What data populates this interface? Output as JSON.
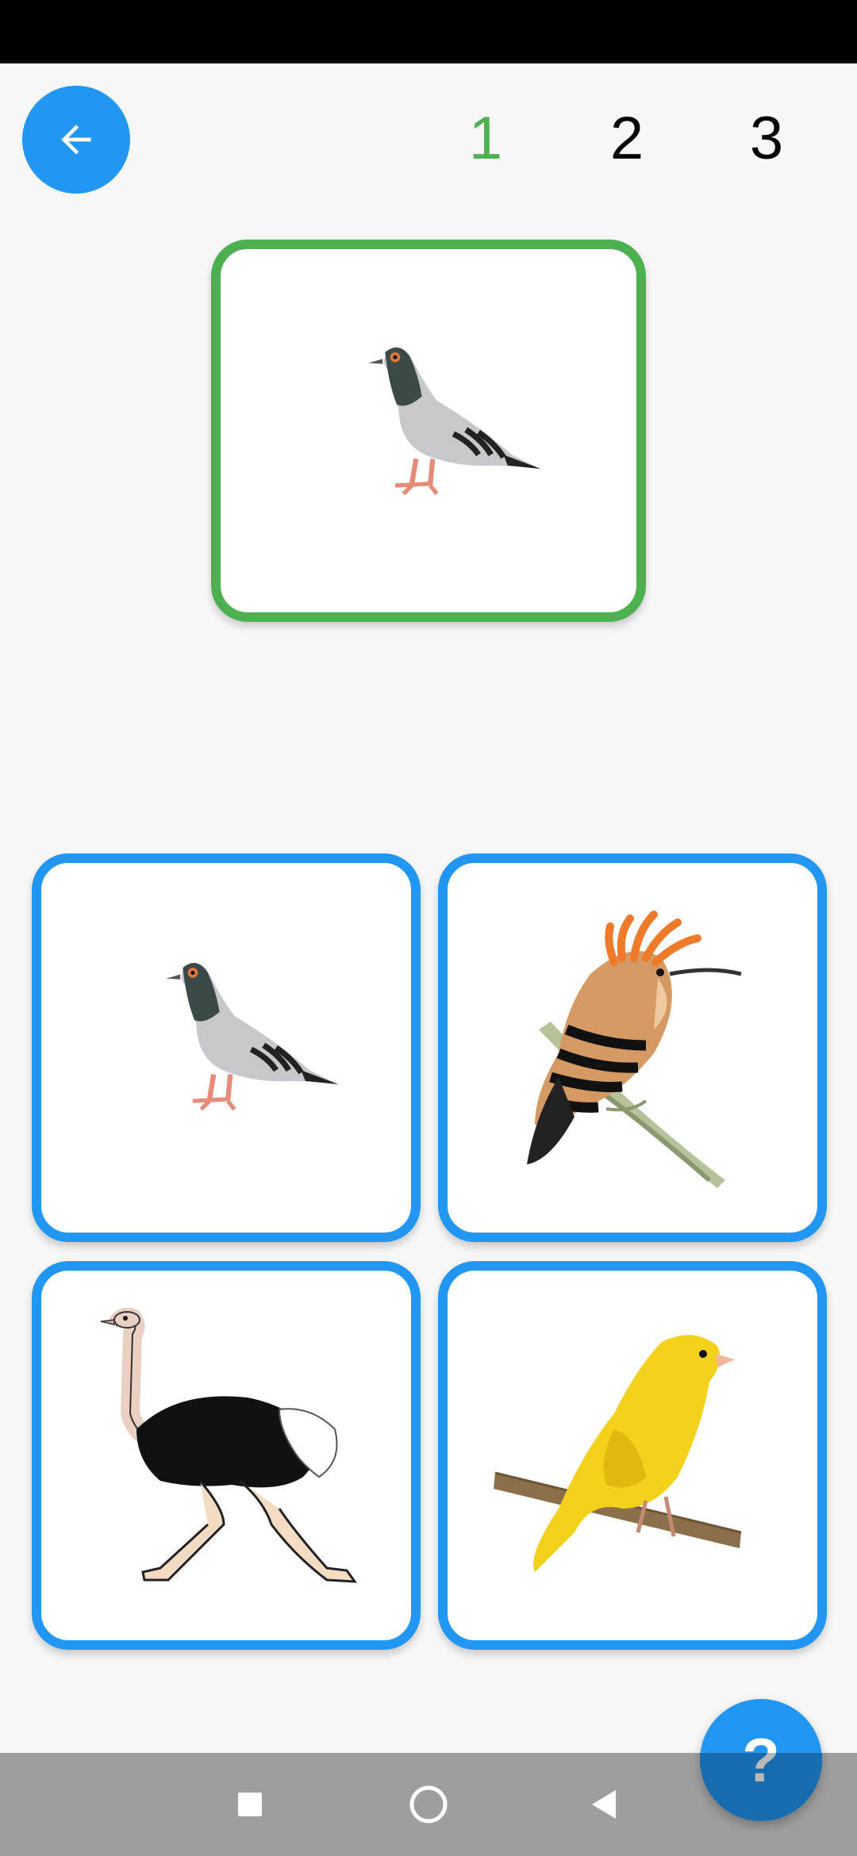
{
  "header": {
    "back_icon": "arrow-left-icon",
    "levels": [
      {
        "label": "1",
        "active": true
      },
      {
        "label": "2",
        "active": false
      },
      {
        "label": "3",
        "active": false
      }
    ]
  },
  "target": {
    "image": "pigeon"
  },
  "options": [
    {
      "image": "pigeon"
    },
    {
      "image": "hoopoe"
    },
    {
      "image": "ostrich"
    },
    {
      "image": "canary"
    }
  ],
  "help": {
    "label": "?"
  },
  "nav": {
    "recents_icon": "square-icon",
    "home_icon": "circle-icon",
    "back_icon": "triangle-back-icon"
  },
  "colors": {
    "accent": "#2196f3",
    "correct": "#4caf50",
    "status_bar": "#000000",
    "nav_bar": "#9e9e9e"
  }
}
